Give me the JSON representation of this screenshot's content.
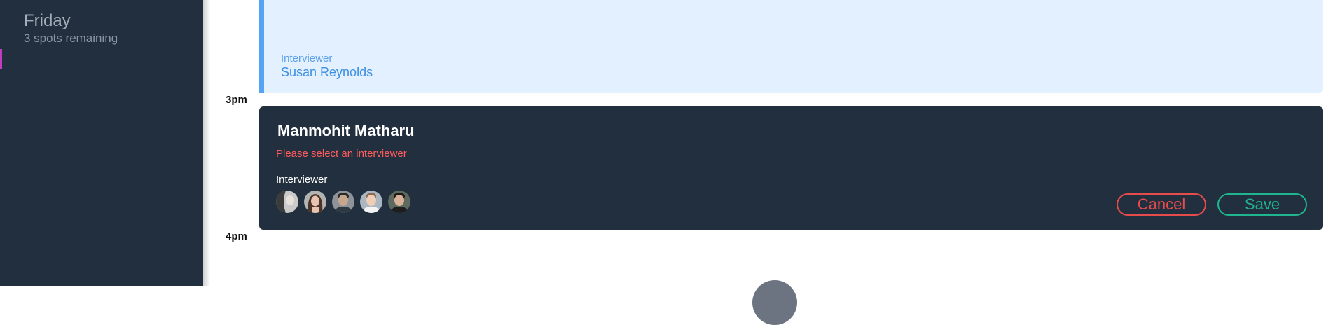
{
  "sidebar": {
    "day": "Friday",
    "spots": "3 spots remaining",
    "accent_color": "#c23dbe"
  },
  "schedule": {
    "times": [
      "3pm",
      "4pm"
    ],
    "booked": {
      "interviewer_label": "Interviewer",
      "interviewer_name": "Susan Reynolds"
    },
    "editor": {
      "student_name": "Manmohit Matharu",
      "error": "Please select an interviewer",
      "interviewer_label": "Interviewer",
      "avatars": [
        "interviewer-avatar-1",
        "interviewer-avatar-2",
        "interviewer-avatar-3",
        "interviewer-avatar-4",
        "interviewer-avatar-5"
      ],
      "cancel_label": "Cancel",
      "save_label": "Save"
    }
  },
  "colors": {
    "sidebar_bg": "#222f3e",
    "booked_bg": "#e3f0ff",
    "booked_accent": "#55a3f5",
    "error": "#ff5c5c",
    "cancel": "#e74c4c",
    "save": "#1fb58e"
  }
}
